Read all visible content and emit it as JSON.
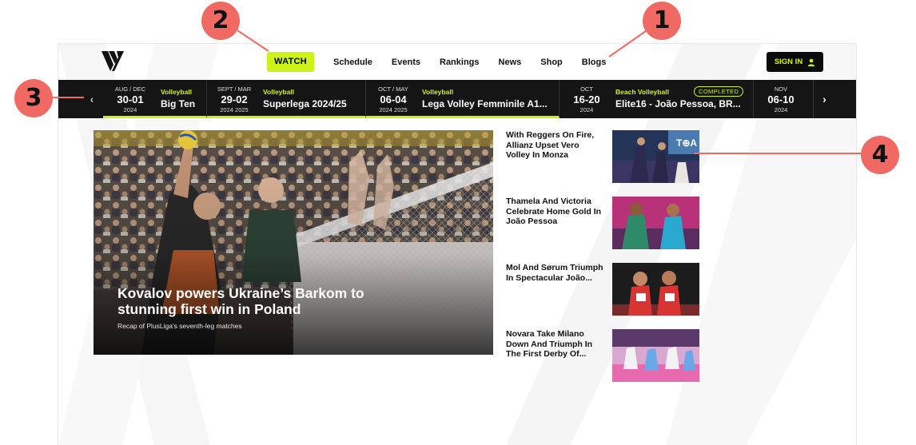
{
  "nav": {
    "watch": "WATCH",
    "items": [
      "Schedule",
      "Events",
      "Rankings",
      "News",
      "Shop",
      "Blogs"
    ],
    "sign_in": "SIGN IN"
  },
  "events": [
    {
      "month": "AUG / DEC",
      "days": "30-01",
      "year": "2024",
      "sport": "Volleyball",
      "name": "Big Ten",
      "active": true
    },
    {
      "month": "SEPT / MAR",
      "days": "29-02",
      "year": "2024 2025",
      "sport": "Volleyball",
      "name": "Superlega 2024/25",
      "active": true
    },
    {
      "month": "OCT / MAY",
      "days": "06-04",
      "year": "2024 2025",
      "sport": "Volleyball",
      "name": "Lega Volley Femminile A1...",
      "active": true
    },
    {
      "month": "OCT",
      "days": "16-20",
      "year": "2024",
      "sport": "Beach Volleyball",
      "name": "Elite16 - João Pessoa, BR...",
      "badge": "COMPLETED",
      "active": false
    },
    {
      "month": "NOV",
      "days": "06-10",
      "year": "2024",
      "sport": "",
      "name": "",
      "active": false
    }
  ],
  "hero": {
    "title": "Kovalov powers Ukraine’s Barkom to stunning first win in Poland",
    "subtitle": "Recap of PlusLiga's seventh-leg matches"
  },
  "stories": [
    {
      "title": "With Reggers On Fire, Allianz Upset Vero Volley In Monza"
    },
    {
      "title": "Thamela And Victoria Celebrate Home Gold In João Pessoa"
    },
    {
      "title": "Mol And Sørum Triumph In Spectacular João..."
    },
    {
      "title": "Novara Take Milano Down And Triumph In The First Derby Of..."
    }
  ],
  "annotations": [
    "1",
    "2",
    "3",
    "4"
  ],
  "colors": {
    "accent": "#ccf21a",
    "strip": "#151515",
    "callout": "#f06a63"
  }
}
